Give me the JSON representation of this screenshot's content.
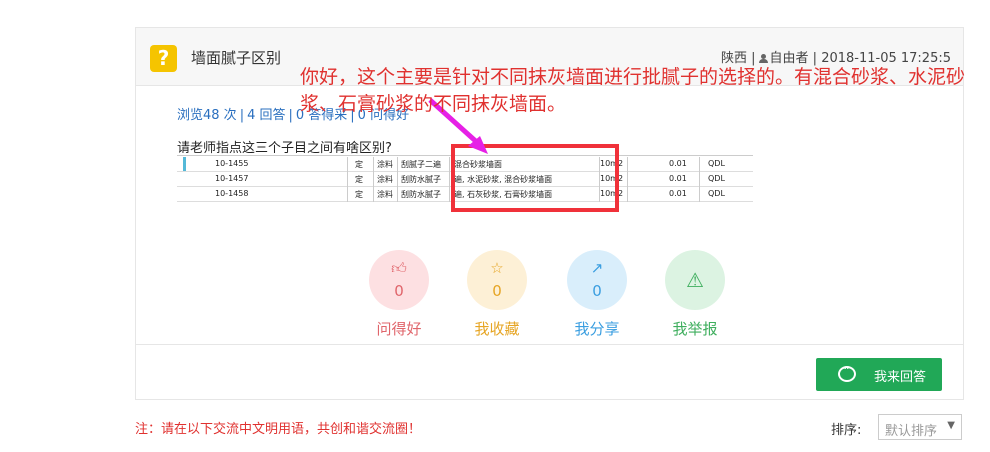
{
  "header": {
    "title": "墙面腻子区别",
    "icon": "question-icon",
    "location": "陕西",
    "author": "自由者",
    "datetime": "2018-11-05 17:25:5"
  },
  "stats": {
    "views": "浏览48 次",
    "answers": "4 回答",
    "adopted": "0 答得采",
    "asked": "0 问得好"
  },
  "question": "请老师指点这三个子目之间有啥区别?",
  "table": {
    "rows": [
      {
        "code": "10-1455",
        "unit": "定",
        "type": "涂料",
        "desc1": "刮腻子二遍",
        "desc2": "混合砂浆墙面",
        "qty": "10m2",
        "amount": "0.01",
        "qdl": "QDL"
      },
      {
        "code": "10-1457",
        "unit": "定",
        "type": "涂料",
        "desc1": "刮防水腻子",
        "desc2": "遍, 水泥砂浆, 混合砂浆墙面",
        "qty": "10m2",
        "amount": "0.01",
        "qdl": "QDL"
      },
      {
        "code": "10-1458",
        "unit": "定",
        "type": "涂料",
        "desc1": "刮防水腻子",
        "desc2": "遍, 石灰砂浆, 石膏砂浆墙面",
        "qty": "10m2",
        "amount": "0.01",
        "qdl": "QDL"
      }
    ]
  },
  "annotation": "你好，这个主要是针对不同抹灰墙面进行批腻子的选择的。有混合砂浆、水泥砂浆、石膏砂浆的不同抹灰墙面。",
  "actions": [
    {
      "label": "问得好",
      "count": "0",
      "icon": "thumbs-up-icon",
      "color": "#e0656b",
      "bg": "#fde0e2"
    },
    {
      "label": "我收藏",
      "count": "0",
      "icon": "star-icon",
      "color": "#e6a524",
      "bg": "#fdf0d6"
    },
    {
      "label": "我分享",
      "count": "0",
      "icon": "share-icon",
      "color": "#3a9ee0",
      "bg": "#d9eefb"
    },
    {
      "label": "我举报",
      "count": "",
      "icon": "warning-icon",
      "color": "#3fae5e",
      "bg": "#dcf3e2"
    }
  ],
  "answer_button": "我来回答",
  "notice": "注：请在以下交流中文明用语，共创和谐交流圈！",
  "sort": {
    "label": "排序:",
    "selected": "默认排序"
  }
}
